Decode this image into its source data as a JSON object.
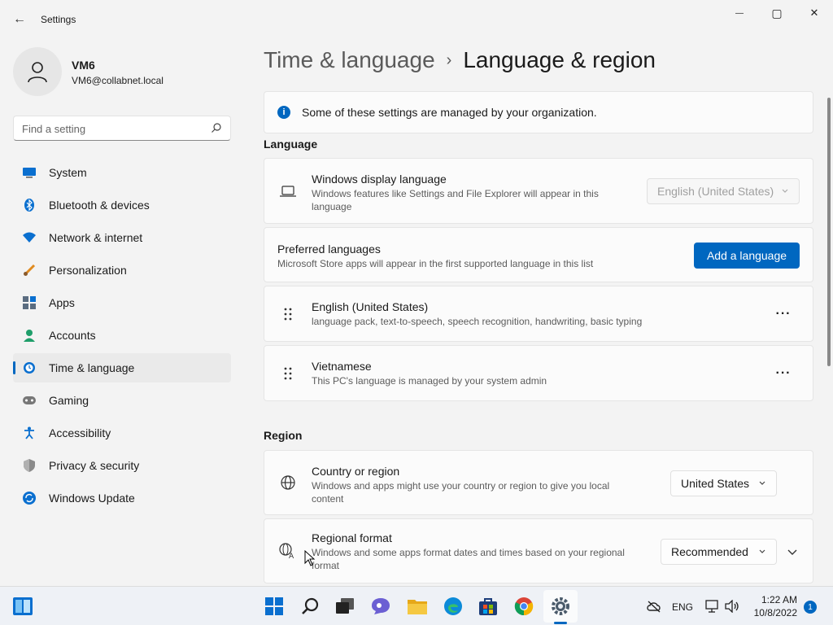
{
  "window": {
    "title": "Settings",
    "back_glyph": "←",
    "minimize_glyph": "—",
    "maximize_glyph": "▢",
    "close_glyph": "✕"
  },
  "profile": {
    "name": "VM6",
    "email": "VM6@collabnet.local"
  },
  "search": {
    "placeholder": "Find a setting"
  },
  "nav": [
    {
      "label": "System",
      "icon": "system-icon",
      "color": "#0a6fcf"
    },
    {
      "label": "Bluetooth & devices",
      "icon": "bluetooth-icon",
      "color": "#0a6fcf"
    },
    {
      "label": "Network & internet",
      "icon": "network-icon",
      "color": "#0a6fcf"
    },
    {
      "label": "Personalization",
      "icon": "brush-icon",
      "color": "#e08a1e"
    },
    {
      "label": "Apps",
      "icon": "apps-icon",
      "color": "#5a6c80"
    },
    {
      "label": "Accounts",
      "icon": "accounts-icon",
      "color": "#1f9e6a"
    },
    {
      "label": "Time & language",
      "icon": "time-language-icon",
      "color": "#0a6fcf",
      "active": true
    },
    {
      "label": "Gaming",
      "icon": "gaming-icon",
      "color": "#666666"
    },
    {
      "label": "Accessibility",
      "icon": "accessibility-icon",
      "color": "#0a6fcf"
    },
    {
      "label": "Privacy & security",
      "icon": "shield-icon",
      "color": "#7a7a7a"
    },
    {
      "label": "Windows Update",
      "icon": "update-icon",
      "color": "#0a6fcf"
    }
  ],
  "breadcrumb": {
    "parent": "Time & language",
    "separator": "›",
    "current": "Language & region"
  },
  "info": {
    "glyph": "i",
    "text": "Some of these settings are managed by your organization."
  },
  "language": {
    "section_title": "Language",
    "display": {
      "title": "Windows display language",
      "subtitle": "Windows features like Settings and File Explorer will appear in this language",
      "value": "English (United States)"
    },
    "preferred": {
      "title": "Preferred languages",
      "subtitle": "Microsoft Store apps will appear in the first supported language in this list",
      "button": "Add a language"
    },
    "items": [
      {
        "title": "English (United States)",
        "subtitle": "language pack, text-to-speech, speech recognition, handwriting, basic typing",
        "more": "···"
      },
      {
        "title": "Vietnamese",
        "subtitle": "This PC's language is managed by your system admin",
        "more": "···"
      }
    ]
  },
  "region": {
    "section_title": "Region",
    "country": {
      "title": "Country or region",
      "subtitle": "Windows and apps might use your country or region to give you local content",
      "value": "United States"
    },
    "format": {
      "title": "Regional format",
      "subtitle": "Windows and some apps format dates and times based on your regional format",
      "value": "Recommended"
    }
  },
  "taskbar": {
    "tray_lang": "ENG",
    "time": "1:22 AM",
    "date": "10/8/2022",
    "notification_count": "1"
  },
  "colors": {
    "accent": "#0067c0"
  }
}
